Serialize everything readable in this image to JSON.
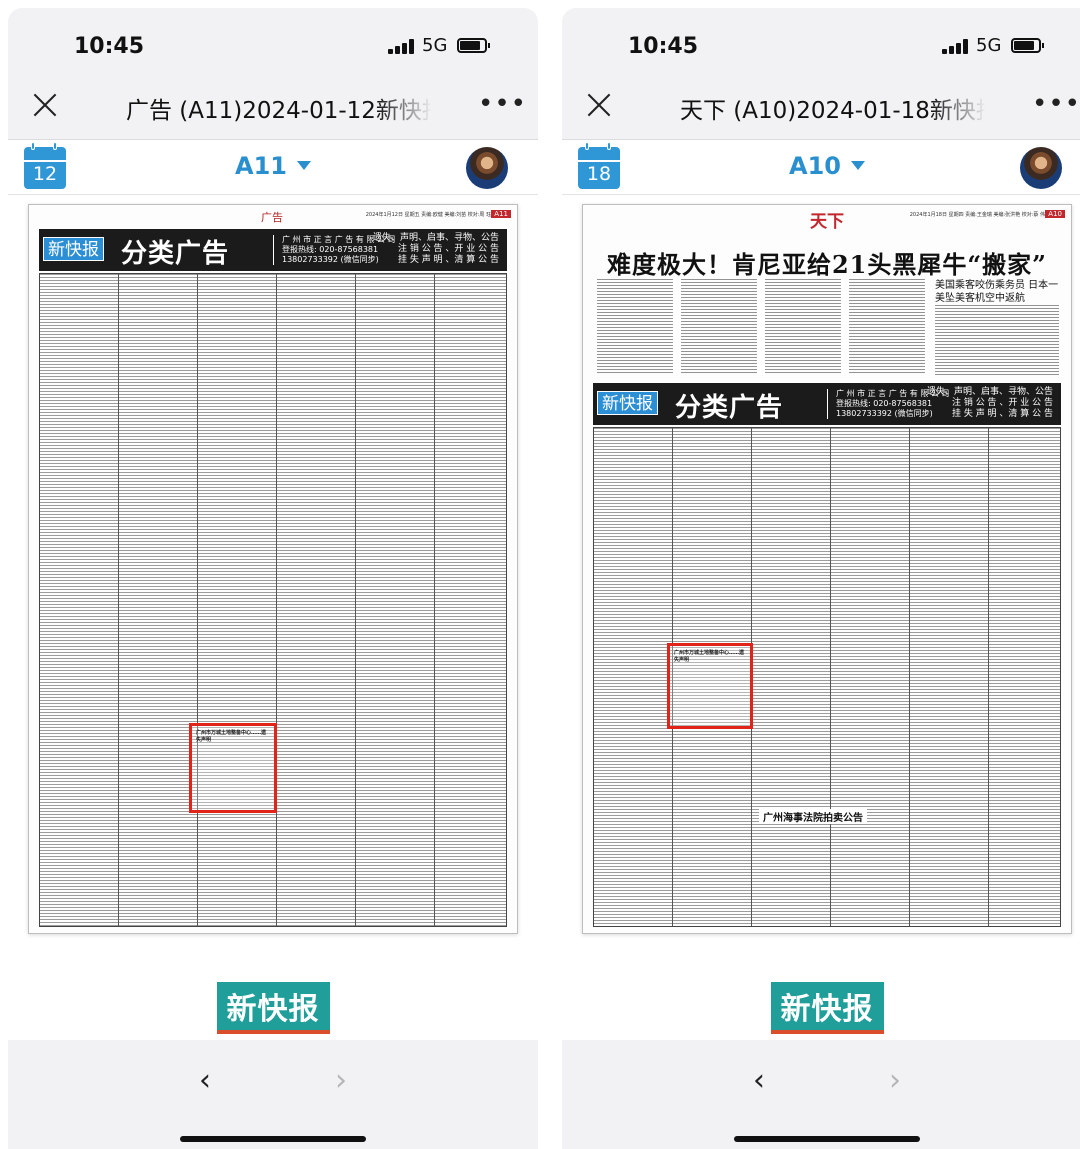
{
  "screens": [
    {
      "status": {
        "time": "10:45",
        "network": "5G"
      },
      "title": "广告 (A11)2024-01-12新快报",
      "calendar_day": "12",
      "edition": "A11",
      "paper": {
        "section": "广告",
        "date_line": "2024年1月12日 星期五 责编:欧健 美编:刘苗 校对:周 珏",
        "page_no": "A11",
        "ad_logo": "新快报",
        "ad_title": "分类广告",
        "contact_line1": "广 州 市 正 言 广 告 有 限 公 司",
        "contact_line2": "登报热线: 020-87568381",
        "contact_line3": "13802733392 (微信同步)",
        "cats_line1": "遗失、声明、启事、寻物、公告",
        "cats_line2": "注 销 公 告 、开 业 公 告",
        "cats_line3": "挂 失 声 明 、清 算 公 告",
        "highlight_text": "广州市万城土地整备中心……遗失声明"
      },
      "brand": "新快报"
    },
    {
      "status": {
        "time": "10:45",
        "network": "5G"
      },
      "title": "天下 (A10)2024-01-18新快报",
      "calendar_day": "18",
      "edition": "A10",
      "paper": {
        "section": "天下",
        "date_line": "2024年1月18日 星期四 责编:王金瑞 美编:张洪艳 校对:蔡 伟",
        "page_no": "A10",
        "headline": "难度极大！肯尼亚给21头黑犀牛“搬家”",
        "side_title": "美国乘客咬伤乘务员 日本一美坠美客机空中返航",
        "ad_logo": "新快报",
        "ad_title": "分类广告",
        "contact_line1": "广 州 市 正 言 广 告 有 限 公 司",
        "contact_line2": "登报热线: 020-87568381",
        "contact_line3": "13802733392 (微信同步)",
        "cats_line1": "遗失、声明、启事、寻物、公告",
        "cats_line2": "注 销 公 告 、开 业 公 告",
        "cats_line3": "挂 失 声 明 、清 算 公 告",
        "highlight_text": "广州市万城土地整备中心……遗失声明",
        "auction_title": "广州海事法院拍卖公告"
      },
      "brand": "新快报"
    }
  ],
  "colors": {
    "accent": "#2a8fcf",
    "highlight": "#e2231a",
    "brand_bg": "#1f9e9a",
    "brand_line": "#d94f2b"
  },
  "icons": [
    "close-icon",
    "more-icon",
    "calendar-icon",
    "caret-down-icon",
    "avatar",
    "back-chevron-icon",
    "forward-chevron-icon"
  ]
}
